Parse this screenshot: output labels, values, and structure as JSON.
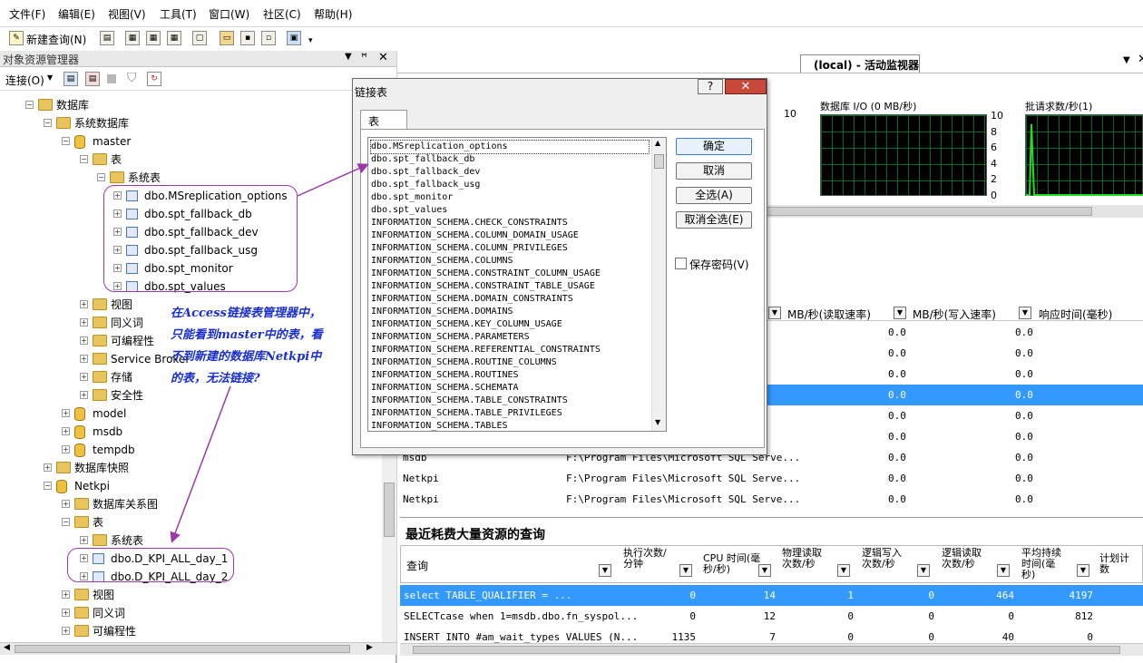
{
  "menu": [
    "文件(F)",
    "编辑(E)",
    "视图(V)",
    "工具(T)",
    "窗口(W)",
    "社区(C)",
    "帮助(H)"
  ],
  "toolbar": {
    "new_query": "新建查询(N)"
  },
  "object_explorer": {
    "title": "对象资源管理器",
    "connect": "连接(O)",
    "tree": [
      {
        "label": "数据库",
        "kind": "folder",
        "indent": 0,
        "exp": "-"
      },
      {
        "label": "系统数据库",
        "kind": "folder",
        "indent": 1,
        "exp": "-"
      },
      {
        "label": "master",
        "kind": "db",
        "indent": 2,
        "exp": "-"
      },
      {
        "label": "表",
        "kind": "folder",
        "indent": 3,
        "exp": "-"
      },
      {
        "label": "系统表",
        "kind": "folder",
        "indent": 4,
        "exp": "-"
      },
      {
        "label": "dbo.MSreplication_options",
        "kind": "table",
        "indent": 5,
        "exp": "+"
      },
      {
        "label": "dbo.spt_fallback_db",
        "kind": "table",
        "indent": 5,
        "exp": "+"
      },
      {
        "label": "dbo.spt_fallback_dev",
        "kind": "table",
        "indent": 5,
        "exp": "+"
      },
      {
        "label": "dbo.spt_fallback_usg",
        "kind": "table",
        "indent": 5,
        "exp": "+"
      },
      {
        "label": "dbo.spt_monitor",
        "kind": "table",
        "indent": 5,
        "exp": "+"
      },
      {
        "label": "dbo.spt_values",
        "kind": "table",
        "indent": 5,
        "exp": "+"
      },
      {
        "label": "视图",
        "kind": "folder",
        "indent": 3,
        "exp": "+"
      },
      {
        "label": "同义词",
        "kind": "folder",
        "indent": 3,
        "exp": "+"
      },
      {
        "label": "可编程性",
        "kind": "folder",
        "indent": 3,
        "exp": "+"
      },
      {
        "label": "Service Broker",
        "kind": "folder",
        "indent": 3,
        "exp": "+"
      },
      {
        "label": "存储",
        "kind": "folder",
        "indent": 3,
        "exp": "+"
      },
      {
        "label": "安全性",
        "kind": "folder",
        "indent": 3,
        "exp": "+"
      },
      {
        "label": "model",
        "kind": "db",
        "indent": 2,
        "exp": "+"
      },
      {
        "label": "msdb",
        "kind": "db",
        "indent": 2,
        "exp": "+"
      },
      {
        "label": "tempdb",
        "kind": "db",
        "indent": 2,
        "exp": "+"
      },
      {
        "label": "数据库快照",
        "kind": "folder",
        "indent": 1,
        "exp": "+"
      },
      {
        "label": "Netkpi",
        "kind": "db",
        "indent": 1,
        "exp": "-"
      },
      {
        "label": "数据库关系图",
        "kind": "folder",
        "indent": 2,
        "exp": "+"
      },
      {
        "label": "表",
        "kind": "folder",
        "indent": 2,
        "exp": "-"
      },
      {
        "label": "系统表",
        "kind": "folder",
        "indent": 3,
        "exp": "+"
      },
      {
        "label": "dbo.D_KPI_ALL_day_1",
        "kind": "table",
        "indent": 3,
        "exp": "+"
      },
      {
        "label": "dbo.D_KPI_ALL_day_2",
        "kind": "table",
        "indent": 3,
        "exp": "+"
      },
      {
        "label": "视图",
        "kind": "folder",
        "indent": 2,
        "exp": "+"
      },
      {
        "label": "同义词",
        "kind": "folder",
        "indent": 2,
        "exp": "+"
      },
      {
        "label": "可编程性",
        "kind": "folder",
        "indent": 2,
        "exp": "+"
      }
    ]
  },
  "annotation": {
    "lines": [
      "在Access链接表管理器中，",
      "只能看到master中的表，看",
      "不到新建的数据库Netkpi中",
      "的表，无法链接?"
    ]
  },
  "monitor": {
    "tab": "(local) - 活动监视器",
    "graph1_top": "10",
    "graph_db_io_title": "数据库 I/O (0 MB/秒)",
    "graph_batch_title": "批请求数/秒(1)",
    "axis": [
      "10",
      "8",
      "6",
      "4",
      "2",
      "0"
    ],
    "io_headers": [
      "MB/秒(读取速率)",
      "MB/秒(写入速率)",
      "响应时间(毫秒)"
    ],
    "io_rows": [
      {
        "db": "",
        "file": "...",
        "r": "0.0",
        "w": "0.0"
      },
      {
        "db": "",
        "file": "...",
        "r": "0.0",
        "w": "0.0"
      },
      {
        "db": "",
        "file": "...",
        "r": "0.0",
        "w": "0.0"
      },
      {
        "db": "",
        "file": "...",
        "r": "0.0",
        "w": "0.0"
      },
      {
        "db": "",
        "file": "...",
        "r": "0.0",
        "w": "0.0"
      },
      {
        "db": "",
        "file": "...",
        "r": "0.0",
        "w": "0.0"
      },
      {
        "db": "msdb",
        "file": "F:\\Program Files\\Microsoft SQL Serve...",
        "r": "0.0",
        "w": "0.0"
      },
      {
        "db": "Netkpi",
        "file": "F:\\Program Files\\Microsoft SQL Serve...",
        "r": "0.0",
        "w": "0.0"
      },
      {
        "db": "Netkpi",
        "file": "F:\\Program Files\\Microsoft SQL Serve...",
        "r": "0.0",
        "w": "0.0"
      }
    ],
    "queries_title": "最近耗费大量资源的查询",
    "query_headers": [
      "查询",
      "执行次数/分钟",
      "CPU 时间(毫秒/秒)",
      "物理读取次数/秒",
      "逻辑写入次数/秒",
      "逻辑读取次数/秒",
      "平均持续时间(毫秒)",
      "计划计数"
    ],
    "query_rows": [
      {
        "q": "select          TABLE_QUALIFIER = ...",
        "c1": "0",
        "c2": "14",
        "c3": "1",
        "c4": "0",
        "c5": "464",
        "c6": "4197"
      },
      {
        "q": "SELECTcase when 1=msdb.dbo.fn_syspol...",
        "c1": "0",
        "c2": "12",
        "c3": "0",
        "c4": "0",
        "c5": "0",
        "c6": "812"
      },
      {
        "q": "INSERT INTO #am_wait_types VALUES (N...",
        "c1": "1135",
        "c2": "7",
        "c3": "0",
        "c4": "0",
        "c5": "40",
        "c6": "0"
      }
    ]
  },
  "dialog": {
    "title": "链接表",
    "tab": "表",
    "ok": "确定",
    "cancel": "取消",
    "select_all": "全选(A)",
    "deselect_all": "取消全选(E)",
    "save_password": "保存密码(V)",
    "help": "?",
    "tables": [
      "dbo.MSreplication_options",
      "dbo.spt_fallback_db",
      "dbo.spt_fallback_dev",
      "dbo.spt_fallback_usg",
      "dbo.spt_monitor",
      "dbo.spt_values",
      "INFORMATION_SCHEMA.CHECK_CONSTRAINTS",
      "INFORMATION_SCHEMA.COLUMN_DOMAIN_USAGE",
      "INFORMATION_SCHEMA.COLUMN_PRIVILEGES",
      "INFORMATION_SCHEMA.COLUMNS",
      "INFORMATION_SCHEMA.CONSTRAINT_COLUMN_USAGE",
      "INFORMATION_SCHEMA.CONSTRAINT_TABLE_USAGE",
      "INFORMATION_SCHEMA.DOMAIN_CONSTRAINTS",
      "INFORMATION_SCHEMA.DOMAINS",
      "INFORMATION_SCHEMA.KEY_COLUMN_USAGE",
      "INFORMATION_SCHEMA.PARAMETERS",
      "INFORMATION_SCHEMA.REFERENTIAL_CONSTRAINTS",
      "INFORMATION_SCHEMA.ROUTINE_COLUMNS",
      "INFORMATION_SCHEMA.ROUTINES",
      "INFORMATION_SCHEMA.SCHEMATA",
      "INFORMATION_SCHEMA.TABLE_CONSTRAINTS",
      "INFORMATION_SCHEMA.TABLE_PRIVILEGES",
      "INFORMATION_SCHEMA.TABLES"
    ]
  },
  "colors": {
    "selection": "#3399ff",
    "annotation": "#1a2ecc",
    "highlight": "#9a3aa8"
  }
}
